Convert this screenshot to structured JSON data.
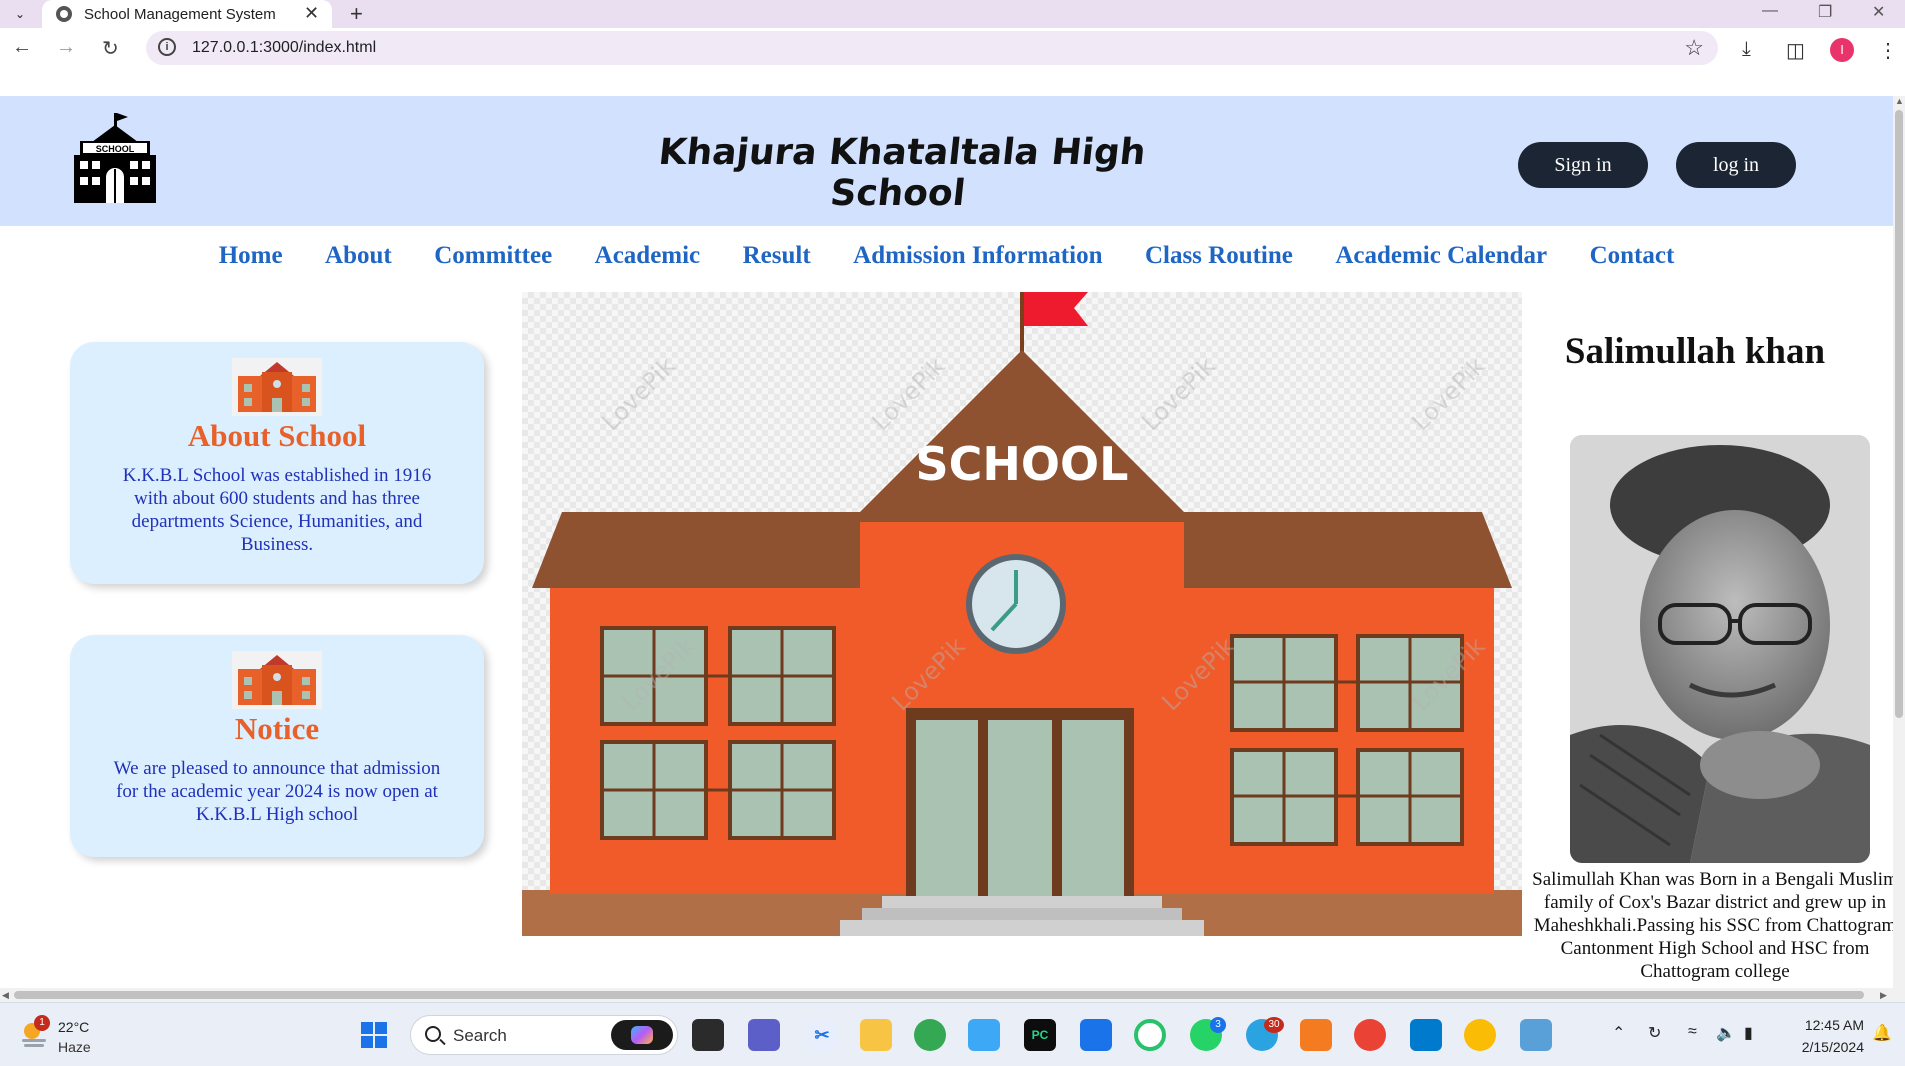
{
  "browser": {
    "tab_title": "School Management System",
    "url": "127.0.0.1:3000/index.html"
  },
  "header": {
    "school_name": "Khajura Khataltala High School",
    "logo_text": "SCHOOL",
    "sign_in_label": "Sign in",
    "log_in_label": "log in"
  },
  "nav": {
    "items": [
      "Home",
      "About",
      "Committee",
      "Academic",
      "Result",
      "Admission Information",
      "Class Routine",
      "Academic Calendar",
      "Contact"
    ]
  },
  "about_card": {
    "title": "About School",
    "text": "K.K.B.L School was established in 1916 with about 600 students and has three departments Science, Humanities, and Business."
  },
  "notice_card": {
    "title": "Notice",
    "text": "We are pleased to announce that admission for the academic year 2024 is now open at K.K.B.L High school"
  },
  "hero": {
    "building_label": "SCHOOL",
    "watermark": "LovePik"
  },
  "profile": {
    "name": "Salimullah khan",
    "bio": "Salimullah Khan was Born in a Bengali Muslim family of Cox's Bazar district and grew up in Maheshkhali.Passing his SSC from Chattogram Cantonment High School and HSC from Chattogram college"
  },
  "taskbar": {
    "weather_temp": "22°C",
    "weather_condition": "Haze",
    "weather_badge": "1",
    "search_label": "Search",
    "whatsapp_badge": "3",
    "telegram_badge": "30",
    "time": "12:45 AM",
    "date": "2/15/2024"
  },
  "colors": {
    "header_bg": "#d2e1fd",
    "nav_link": "#1f66c4",
    "card_bg": "#dcefff",
    "card_title": "#e8612a",
    "card_text": "#2030b8",
    "button_bg": "#1c2533"
  }
}
